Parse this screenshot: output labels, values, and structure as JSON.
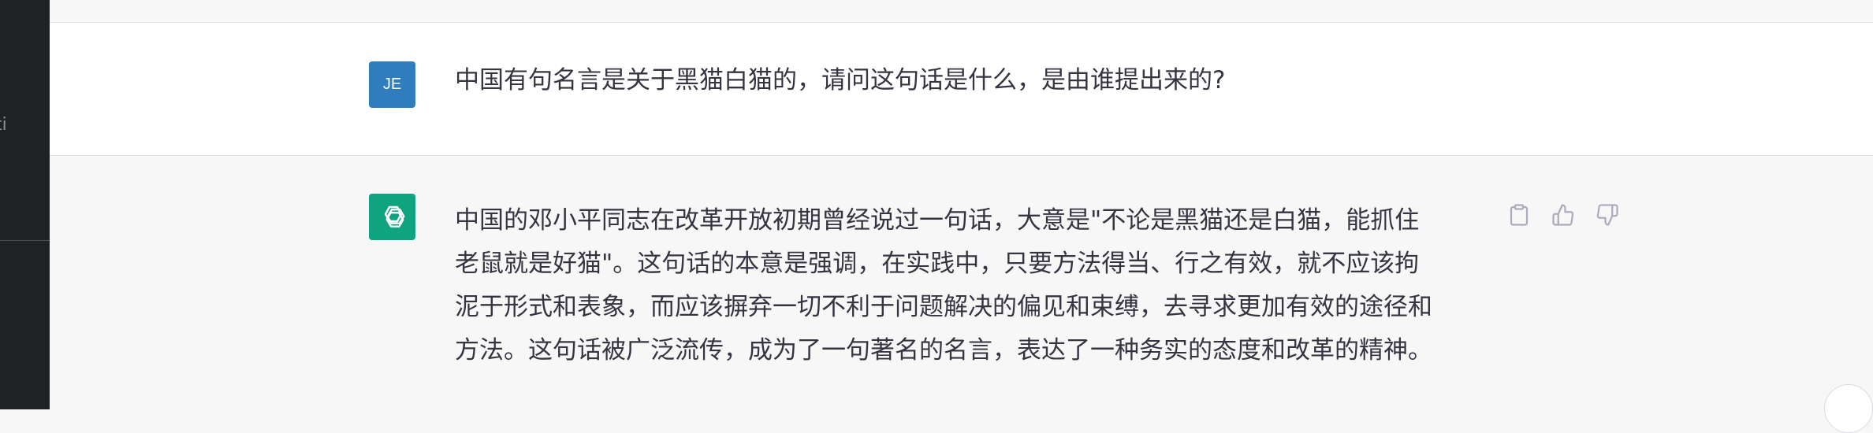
{
  "sidebar": {
    "clipped_text": "ti"
  },
  "conversation": {
    "user_message": {
      "avatar_initials": "JE",
      "text": "中国有句名言是关于黑猫白猫的，请问这句话是什么，是由谁提出来的?"
    },
    "assistant_message": {
      "avatar_icon": "openai-logo-icon",
      "lines": [
        "中国的邓小平同志在改革开放初期曾经说过一句话，大意是\"不论是黑猫还是白猫，能抓住",
        "老鼠就是好猫\"。这句话的本意是强调，在实践中，只要方法得当、行之有效，就不应该拘",
        "泥于形式和表象，而应该摒弃一切不利于问题解决的偏见和束缚，去寻求更加有效的途径和",
        "方法。这句话被广泛流传，成为了一句著名的名言，表达了一种务实的态度和改革的精神。"
      ],
      "actions": [
        "copy-icon",
        "thumbs-up-icon",
        "thumbs-down-icon"
      ]
    }
  },
  "colors": {
    "sidebar_bg": "#202123",
    "user_avatar_bg": "#2f7dbd",
    "bot_avatar_bg": "#10a37f",
    "text": "#343541",
    "icon": "#acacbe"
  }
}
